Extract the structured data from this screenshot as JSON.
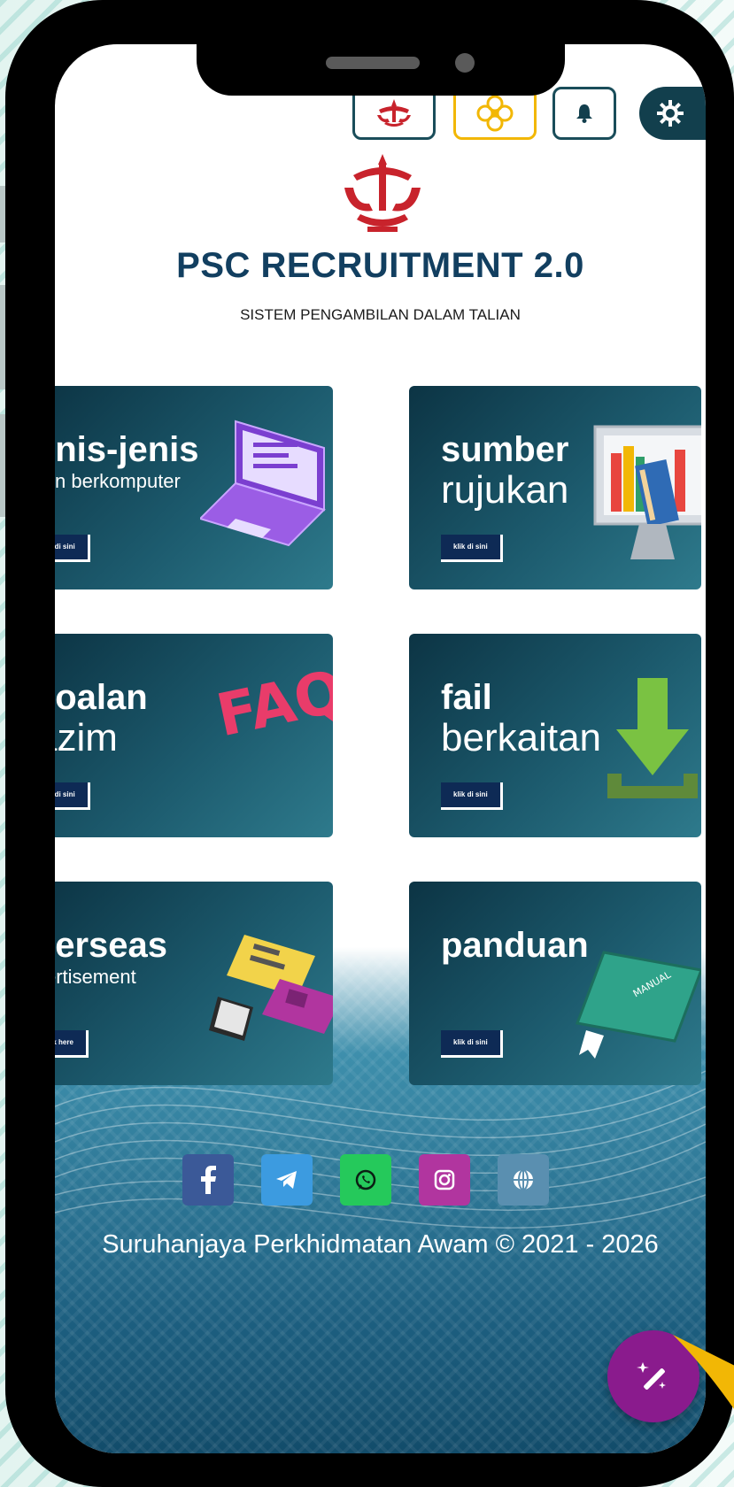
{
  "header": {
    "buttons": [
      {
        "icon": "brunei-emblem-icon"
      },
      {
        "icon": "flower-icon"
      },
      {
        "icon": "bell-icon"
      },
      {
        "icon": "gear-icon"
      }
    ]
  },
  "brand": {
    "title": "PSC RECRUITMENT 2.0",
    "subtitle": "SISTEM PENGAMBILAN DALAM TALIAN"
  },
  "cards": {
    "jenis": {
      "line1": "enis-jenis",
      "line2": "jian berkomputer",
      "button": "klik di sini"
    },
    "sumber": {
      "line1": "sumber",
      "line2": "rujukan",
      "button": "klik di sini"
    },
    "soalan": {
      "line1": "soalan",
      "line2": "azim",
      "button": "klik di sini",
      "art": "FAQ"
    },
    "fail": {
      "line1": "fail",
      "line2": "berkaitan",
      "button": "klik di sini"
    },
    "overseas": {
      "line1": "verseas",
      "line2": "vertisement",
      "button": "click here"
    },
    "panduan": {
      "line1": "panduan",
      "button": "klik di sini",
      "art": "MANUAL"
    }
  },
  "social": [
    "facebook-icon",
    "telegram-icon",
    "whatsapp-icon",
    "instagram-icon",
    "globe-icon"
  ],
  "footer": {
    "text": "Suruhanjaya Perkhidmatan Awam © 2021 - 2026"
  },
  "colors": {
    "brand_navy": "#123f60",
    "card_dark": "#0c3444",
    "facebook": "#3b5998",
    "telegram": "#3c9be0",
    "whatsapp": "#25c95b",
    "instagram": "#b1359f",
    "globe": "#5a8fb0",
    "fab": "#8a1b8d",
    "accent_yellow": "#f2b705"
  }
}
